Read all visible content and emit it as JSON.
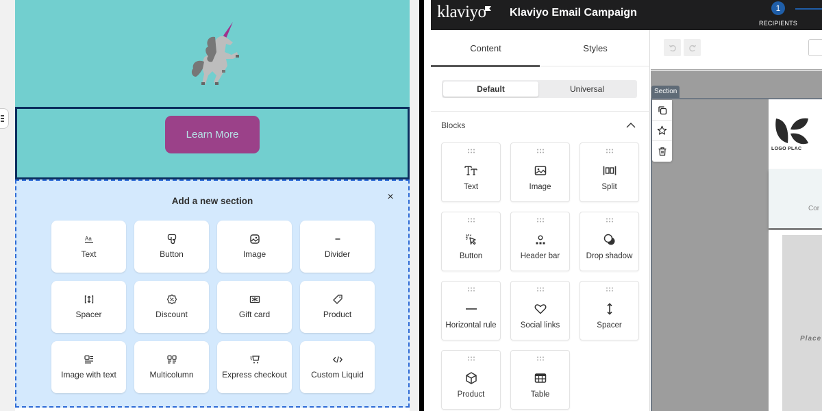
{
  "left_editor": {
    "hero_image_alt": "unicorn-illustration",
    "button_label": "Learn More",
    "colors": {
      "hero_bg": "#72cfcf",
      "button_bg": "#9b4189",
      "selected_border": "#0b2e5e",
      "add_section_bg": "#d4e9fd"
    },
    "add_section": {
      "title": "Add a new section",
      "close_label": "×",
      "items": [
        {
          "label": "Text",
          "icon": "text-aa-icon"
        },
        {
          "label": "Button",
          "icon": "button-tap-icon"
        },
        {
          "label": "Image",
          "icon": "image-icon"
        },
        {
          "label": "Divider",
          "icon": "divider-icon"
        },
        {
          "label": "Spacer",
          "icon": "spacer-icon"
        },
        {
          "label": "Discount",
          "icon": "discount-icon"
        },
        {
          "label": "Gift card",
          "icon": "gift-card-icon"
        },
        {
          "label": "Product",
          "icon": "tag-icon"
        },
        {
          "label": "Image with text",
          "icon": "image-with-text-icon"
        },
        {
          "label": "Multicolumn",
          "icon": "multicolumn-icon"
        },
        {
          "label": "Express checkout",
          "icon": "cart-icon"
        },
        {
          "label": "Custom Liquid",
          "icon": "code-icon"
        }
      ]
    }
  },
  "klaviyo": {
    "logo": "klaviyo",
    "title": "Klaviyo Email Campaign",
    "stepper": {
      "current_step": "1",
      "current_label": "RECIPIENTS",
      "accent": "#1f5ea8"
    },
    "tabs": [
      {
        "label": "Content",
        "active": true
      },
      {
        "label": "Styles",
        "active": false
      }
    ],
    "segmented": {
      "options": [
        "Default",
        "Universal"
      ],
      "selected": "Default"
    },
    "blocks_heading": "Blocks",
    "blocks": [
      {
        "label": "Text",
        "icon": "text-tt-icon"
      },
      {
        "label": "Image",
        "icon": "image-icon"
      },
      {
        "label": "Split",
        "icon": "split-icon"
      },
      {
        "label": "Button",
        "icon": "cursor-click-icon"
      },
      {
        "label": "Header bar",
        "icon": "header-bar-icon"
      },
      {
        "label": "Drop shadow",
        "icon": "drop-shadow-icon"
      },
      {
        "label": "Horizontal rule",
        "icon": "horizontal-rule-icon"
      },
      {
        "label": "Social links",
        "icon": "heart-icon"
      },
      {
        "label": "Spacer",
        "icon": "vertical-arrows-icon"
      },
      {
        "label": "Product",
        "icon": "cube-icon"
      },
      {
        "label": "Table",
        "icon": "table-icon"
      }
    ],
    "canvas": {
      "section_tag": "Section",
      "section_tools": [
        "duplicate",
        "favorite",
        "delete"
      ],
      "logo_text": "LOGO PLAC",
      "content_text": "Cor",
      "placeholder_text": "Place"
    }
  }
}
